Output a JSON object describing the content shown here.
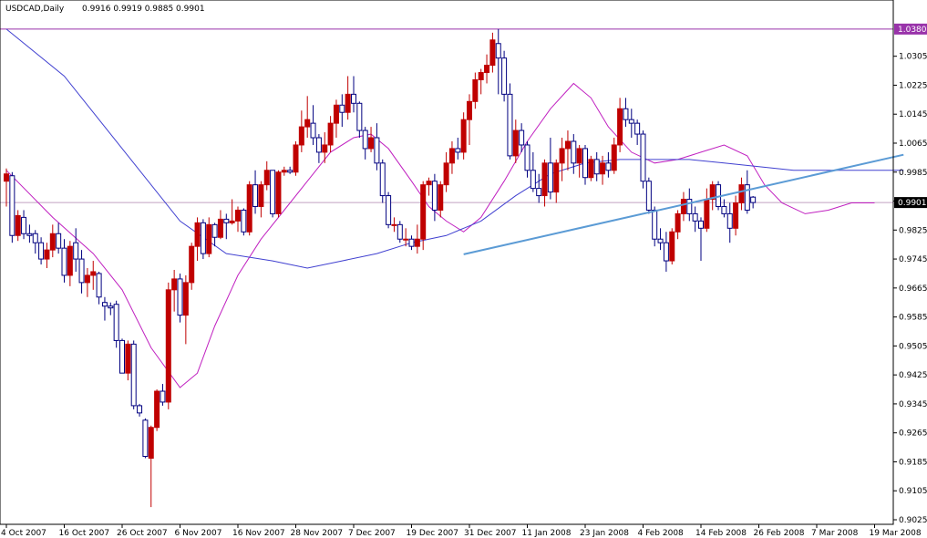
{
  "header": {
    "symbol": "USDCAD,Daily",
    "ohlc": "0.9916 0.9919 0.9885 0.9901"
  },
  "colors": {
    "background": "#ffffff",
    "frame": "#000000",
    "bull_candle": "#c00000",
    "bear_candle": "#000080",
    "ma_fast": "#c020c0",
    "ma_slow": "#4040d0",
    "trendline": "#5b9bd5",
    "hline_resistance": "#9933aa",
    "hline_current": "#c0a0c0",
    "tag_resistance_bg": "#9933aa",
    "tag_current_bg": "#000000",
    "tag_text": "#ffffff"
  },
  "chart_data": {
    "type": "candlestick",
    "symbol": "USDCAD",
    "timeframe": "Daily",
    "grid": false,
    "y_axis_position": "right",
    "ylim": [
      0.9025,
      1.042
    ],
    "y_ticks": [
      "1.0305",
      "1.0225",
      "1.0145",
      "1.0065",
      "0.9985",
      "0.9905",
      "0.9825",
      "0.9745",
      "0.9665",
      "0.9585",
      "0.9505",
      "0.9425",
      "0.9345",
      "0.9265",
      "0.9185",
      "0.9105",
      "0.9025"
    ],
    "x_ticks": [
      {
        "label": "4 Oct 2007",
        "bar": 0
      },
      {
        "label": "16 Oct 2007",
        "bar": 10
      },
      {
        "label": "26 Oct 2007",
        "bar": 20
      },
      {
        "label": "6 Nov 2007",
        "bar": 30
      },
      {
        "label": "16 Nov 2007",
        "bar": 40
      },
      {
        "label": "28 Nov 2007",
        "bar": 50
      },
      {
        "label": "7 Dec 2007",
        "bar": 60
      },
      {
        "label": "19 Dec 2007",
        "bar": 70
      },
      {
        "label": "31 Dec 2007",
        "bar": 80
      },
      {
        "label": "11 Jan 2008",
        "bar": 90
      },
      {
        "label": "23 Jan 2008",
        "bar": 100
      },
      {
        "label": "4 Feb 2008",
        "bar": 110
      },
      {
        "label": "14 Feb 2008",
        "bar": 120
      },
      {
        "label": "26 Feb 2008",
        "bar": 130
      },
      {
        "label": "7 Mar 2008",
        "bar": 140
      },
      {
        "label": "19 Mar 2008",
        "bar": 150
      }
    ],
    "horizontal_lines": [
      {
        "name": "resistance",
        "value": 1.038,
        "label": "1.0380"
      },
      {
        "name": "current",
        "value": 0.9901,
        "label": "0.9901"
      }
    ],
    "trendline": {
      "from": {
        "bar": 79,
        "price": 0.9758
      },
      "to": {
        "bar": 155,
        "price": 1.0033
      }
    },
    "candles": [
      [
        0.996,
        0.9995,
        0.989,
        0.998
      ],
      [
        0.9975,
        0.9985,
        0.979,
        0.981
      ],
      [
        0.981,
        0.988,
        0.9795,
        0.9865
      ],
      [
        0.986,
        0.988,
        0.98,
        0.9815
      ],
      [
        0.9815,
        0.984,
        0.979,
        0.981
      ],
      [
        0.9815,
        0.9825,
        0.976,
        0.979
      ],
      [
        0.979,
        0.9805,
        0.973,
        0.9745
      ],
      [
        0.9745,
        0.979,
        0.972,
        0.977
      ],
      [
        0.977,
        0.984,
        0.975,
        0.9815
      ],
      [
        0.9815,
        0.9845,
        0.976,
        0.9775
      ],
      [
        0.9775,
        0.98,
        0.968,
        0.97
      ],
      [
        0.97,
        0.9795,
        0.967,
        0.978
      ],
      [
        0.979,
        0.983,
        0.971,
        0.9745
      ],
      [
        0.9745,
        0.977,
        0.965,
        0.968
      ],
      [
        0.968,
        0.972,
        0.964,
        0.97
      ],
      [
        0.97,
        0.974,
        0.966,
        0.971
      ],
      [
        0.9705,
        0.971,
        0.962,
        0.964
      ],
      [
        0.9625,
        0.964,
        0.9575,
        0.9615
      ],
      [
        0.9615,
        0.9625,
        0.959,
        0.961
      ],
      [
        0.962,
        0.963,
        0.95,
        0.952
      ],
      [
        0.952,
        0.9525,
        0.943,
        0.943
      ],
      [
        0.943,
        0.952,
        0.941,
        0.951
      ],
      [
        0.951,
        0.952,
        0.933,
        0.934
      ],
      [
        0.934,
        0.9345,
        0.931,
        0.932
      ],
      [
        0.93,
        0.9305,
        0.9195,
        0.92
      ],
      [
        0.9195,
        0.9285,
        0.906,
        0.928
      ],
      [
        0.928,
        0.9385,
        0.927,
        0.938
      ],
      [
        0.938,
        0.94,
        0.934,
        0.935
      ],
      [
        0.935,
        0.968,
        0.933,
        0.966
      ],
      [
        0.966,
        0.9715,
        0.96,
        0.969
      ],
      [
        0.969,
        0.9705,
        0.957,
        0.959
      ],
      [
        0.959,
        0.97,
        0.951,
        0.968
      ],
      [
        0.968,
        0.979,
        0.966,
        0.978
      ],
      [
        0.978,
        0.986,
        0.974,
        0.9845
      ],
      [
        0.9845,
        0.9855,
        0.9745,
        0.976
      ],
      [
        0.976,
        0.986,
        0.975,
        0.984
      ],
      [
        0.984,
        0.9845,
        0.978,
        0.9805
      ],
      [
        0.9805,
        0.988,
        0.98,
        0.9855
      ],
      [
        0.9855,
        0.987,
        0.98,
        0.9845
      ],
      [
        0.9845,
        0.991,
        0.984,
        0.985
      ],
      [
        0.985,
        0.989,
        0.982,
        0.988
      ],
      [
        0.988,
        0.9885,
        0.981,
        0.982
      ],
      [
        0.982,
        0.996,
        0.981,
        0.995
      ],
      [
        0.995,
        0.999,
        0.987,
        0.989
      ],
      [
        0.989,
        0.996,
        0.986,
        0.995
      ],
      [
        0.995,
        1.0015,
        0.9935,
        0.999
      ],
      [
        0.999,
        0.999,
        0.986,
        0.987
      ],
      [
        0.987,
        0.999,
        0.986,
        0.9985
      ],
      [
        0.9985,
        1.0,
        0.9975,
        0.999
      ],
      [
        0.999,
        1.0,
        0.998,
        0.9985
      ],
      [
        0.9985,
        1.007,
        0.9975,
        1.006
      ],
      [
        1.006,
        1.0155,
        1.004,
        1.011
      ],
      [
        1.011,
        1.0195,
        1.008,
        1.013
      ],
      [
        1.012,
        1.017,
        1.006,
        1.008
      ],
      [
        1.008,
        1.009,
        1.001,
        1.004
      ],
      [
        1.004,
        1.0095,
        1.001,
        1.006
      ],
      [
        1.006,
        1.014,
        1.004,
        1.012
      ],
      [
        1.012,
        1.0185,
        1.008,
        1.017
      ],
      [
        1.017,
        1.02,
        1.011,
        1.015
      ],
      [
        1.015,
        1.025,
        1.013,
        1.02
      ],
      [
        1.02,
        1.025,
        1.015,
        1.0175
      ],
      [
        1.0175,
        1.018,
        1.008,
        1.01
      ],
      [
        1.01,
        1.011,
        1.002,
        1.005
      ],
      [
        1.005,
        1.011,
        1.004,
        1.008
      ],
      [
        1.008,
        1.012,
        0.999,
        1.001
      ],
      [
        1.001,
        1.002,
        0.99,
        0.992
      ],
      [
        0.992,
        0.993,
        0.983,
        0.984
      ],
      [
        0.984,
        0.986,
        0.982,
        0.984
      ],
      [
        0.984,
        0.985,
        0.979,
        0.98
      ],
      [
        0.98,
        0.983,
        0.978,
        0.98
      ],
      [
        0.98,
        0.981,
        0.977,
        0.978
      ],
      [
        0.978,
        0.984,
        0.976,
        0.98
      ],
      [
        0.98,
        0.996,
        0.977,
        0.995
      ],
      [
        0.995,
        0.997,
        0.992,
        0.996
      ],
      [
        0.996,
        0.998,
        0.985,
        0.988
      ],
      [
        0.988,
        0.996,
        0.986,
        0.995
      ],
      [
        0.995,
        1.004,
        0.993,
        1.001
      ],
      [
        1.001,
        1.007,
        0.998,
        1.005
      ],
      [
        1.005,
        1.008,
        1.002,
        1.004
      ],
      [
        1.004,
        1.015,
        1.002,
        1.013
      ],
      [
        1.013,
        1.02,
        1.006,
        1.018
      ],
      [
        1.018,
        1.026,
        1.016,
        1.024
      ],
      [
        1.024,
        1.027,
        1.02,
        1.026
      ],
      [
        1.026,
        1.031,
        1.023,
        1.028
      ],
      [
        1.028,
        1.037,
        1.026,
        1.035
      ],
      [
        1.034,
        1.038,
        1.02,
        1.03
      ],
      [
        1.03,
        1.032,
        1.018,
        1.02
      ],
      [
        1.02,
        1.023,
        1.002,
        1.003
      ],
      [
        1.003,
        1.013,
        1.001,
        1.01
      ],
      [
        1.01,
        1.012,
        1.004,
        1.006
      ],
      [
        1.006,
        1.007,
        0.997,
        0.999
      ],
      [
        0.999,
        1.004,
        0.993,
        0.994
      ],
      [
        0.994,
        0.998,
        0.99,
        0.992
      ],
      [
        0.992,
        1.002,
        0.989,
        1.001
      ],
      [
        1.001,
        1.008,
        0.991,
        0.993
      ],
      [
        0.993,
        1.002,
        0.99,
        1.001
      ],
      [
        1.001,
        1.008,
        0.996,
        1.005
      ],
      [
        1.005,
        1.01,
        0.999,
        1.007
      ],
      [
        1.007,
        1.009,
        0.998,
        1.001
      ],
      [
        1.001,
        1.006,
        0.997,
        1.005
      ],
      [
        1.005,
        1.006,
        0.995,
        0.997
      ],
      [
        0.997,
        1.003,
        0.996,
        1.002
      ],
      [
        1.002,
        1.004,
        0.996,
        0.998
      ],
      [
        0.998,
        1.003,
        0.995,
        1.001
      ],
      [
        1.001,
        1.004,
        0.997,
        0.999
      ],
      [
        0.999,
        1.008,
        0.998,
        1.006
      ],
      [
        1.006,
        1.019,
        1.004,
        1.016
      ],
      [
        1.016,
        1.019,
        1.011,
        1.013
      ],
      [
        1.013,
        1.016,
        1.008,
        1.012
      ],
      [
        1.012,
        1.013,
        1.006,
        1.009
      ],
      [
        1.009,
        1.01,
        0.994,
        0.996
      ],
      [
        0.996,
        0.997,
        0.987,
        0.988
      ],
      [
        0.988,
        0.989,
        0.978,
        0.98
      ],
      [
        0.98,
        0.983,
        0.977,
        0.979
      ],
      [
        0.979,
        0.982,
        0.971,
        0.974
      ],
      [
        0.974,
        0.983,
        0.973,
        0.982
      ],
      [
        0.982,
        0.988,
        0.98,
        0.987
      ],
      [
        0.987,
        0.993,
        0.985,
        0.991
      ],
      [
        0.991,
        0.994,
        0.985,
        0.987
      ],
      [
        0.987,
        0.989,
        0.982,
        0.985
      ],
      [
        0.985,
        0.986,
        0.974,
        0.983
      ],
      [
        0.983,
        0.994,
        0.982,
        0.991
      ],
      [
        0.991,
        0.996,
        0.988,
        0.995
      ],
      [
        0.995,
        0.996,
        0.988,
        0.989
      ],
      [
        0.989,
        0.991,
        0.986,
        0.987
      ],
      [
        0.987,
        0.99,
        0.979,
        0.983
      ],
      [
        0.983,
        0.992,
        0.981,
        0.99
      ],
      [
        0.99,
        0.997,
        0.988,
        0.995
      ],
      [
        0.995,
        0.999,
        0.987,
        0.988
      ],
      [
        0.9916,
        0.9919,
        0.9885,
        0.9901
      ]
    ],
    "ma_fast": [
      [
        0,
        0.999
      ],
      [
        8,
        0.986
      ],
      [
        15,
        0.976
      ],
      [
        20,
        0.966
      ],
      [
        25,
        0.95
      ],
      [
        30,
        0.939
      ],
      [
        33,
        0.943
      ],
      [
        36,
        0.956
      ],
      [
        40,
        0.97
      ],
      [
        44,
        0.98
      ],
      [
        48,
        0.988
      ],
      [
        52,
        0.996
      ],
      [
        56,
        1.004
      ],
      [
        60,
        1.008
      ],
      [
        63,
        1.009
      ],
      [
        66,
        1.005
      ],
      [
        70,
        0.996
      ],
      [
        73,
        0.989
      ],
      [
        76,
        0.985
      ],
      [
        79,
        0.982
      ],
      [
        82,
        0.986
      ],
      [
        86,
        0.996
      ],
      [
        90,
        1.007
      ],
      [
        94,
        1.016
      ],
      [
        98,
        1.023
      ],
      [
        101,
        1.019
      ],
      [
        104,
        1.011
      ],
      [
        108,
        1.004
      ],
      [
        112,
        1.001
      ],
      [
        116,
        1.002
      ],
      [
        120,
        1.004
      ],
      [
        124,
        1.006
      ],
      [
        128,
        1.003
      ],
      [
        131,
        0.995
      ],
      [
        134,
        0.99
      ],
      [
        138,
        0.987
      ],
      [
        142,
        0.988
      ],
      [
        146,
        0.99
      ],
      [
        150,
        0.99
      ]
    ],
    "ma_slow": [
      [
        0,
        1.038
      ],
      [
        10,
        1.025
      ],
      [
        20,
        1.005
      ],
      [
        30,
        0.985
      ],
      [
        38,
        0.976
      ],
      [
        46,
        0.974
      ],
      [
        52,
        0.972
      ],
      [
        58,
        0.974
      ],
      [
        64,
        0.976
      ],
      [
        70,
        0.979
      ],
      [
        76,
        0.981
      ],
      [
        82,
        0.985
      ],
      [
        88,
        0.992
      ],
      [
        94,
        0.998
      ],
      [
        100,
        1.001
      ],
      [
        106,
        1.002
      ],
      [
        112,
        1.002
      ],
      [
        118,
        1.002
      ],
      [
        124,
        1.001
      ],
      [
        130,
        1.0
      ],
      [
        136,
        0.999
      ],
      [
        142,
        0.999
      ],
      [
        148,
        0.999
      ],
      [
        155,
        0.999
      ]
    ]
  }
}
